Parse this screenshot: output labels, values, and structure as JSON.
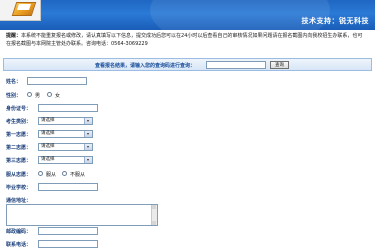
{
  "header": {
    "banner_text": "技术支持：锐无科技"
  },
  "notice": {
    "prefix": "提醒：",
    "text": "本系统不能重复报名或修改，请认真填写以下信息，提交成功后您可以在24小时以后查看自己的审核情况如果问题请在报名截图内向我校招生办联系，也可在报名截图与本网院主管处办联系。咨询电话：0564-3069229"
  },
  "search": {
    "label": "查看报名结果，请输入您的查询码进行查询：",
    "input_value": "",
    "button_label": "查询"
  },
  "form": {
    "name_label": "姓名：",
    "gender_label": "性别：",
    "gender_options": [
      "男",
      "女"
    ],
    "id_label": "身份证号：",
    "category_label": "考生类别：",
    "choice1_label": "第一志愿：",
    "choice2_label": "第二志愿：",
    "choice3_label": "第三志愿：",
    "select_placeholder": "请选择",
    "adjust_label": "服从志愿：",
    "adjust_options": [
      "服从",
      "不服从"
    ],
    "school_label": "毕业学校：",
    "address_label": "通信地址：",
    "postcode_label": "邮政编码：",
    "phone_label": "联系电话："
  },
  "colors": {
    "header_blue": "#1f67c2",
    "label_navy": "#1b3f7a",
    "search_bar": "#d7e6f7"
  }
}
